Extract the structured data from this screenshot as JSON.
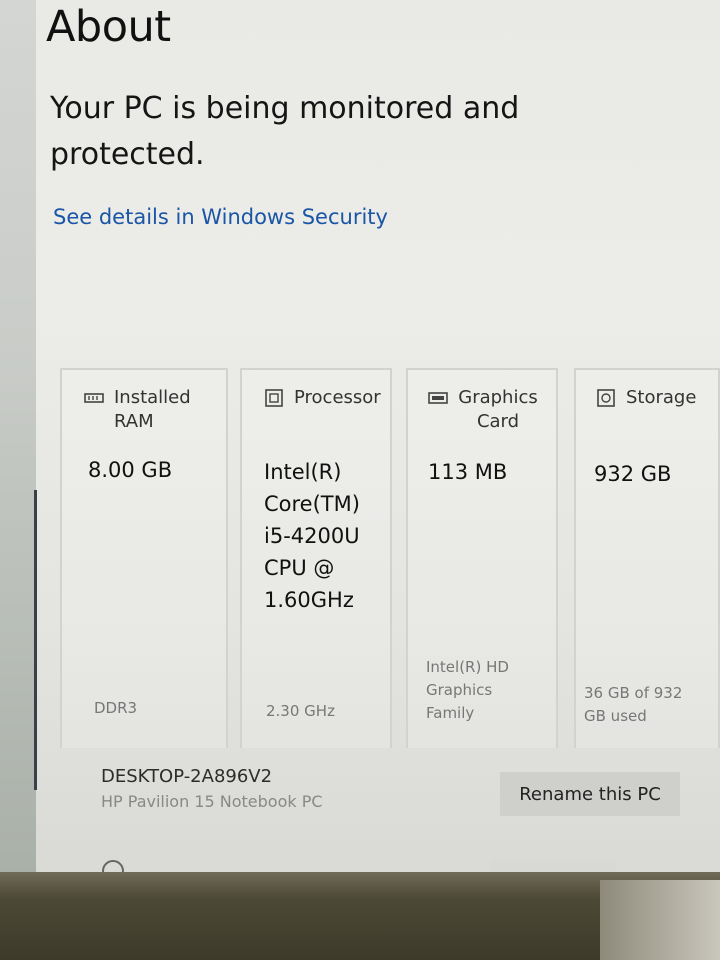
{
  "page": {
    "title": "About",
    "security_message": "Your PC is being monitored and protected.",
    "security_link": "See details in Windows Security"
  },
  "specs": [
    {
      "icon": "memory-icon",
      "label": "Installed RAM",
      "value": "8.00 GB",
      "detail": "DDR3"
    },
    {
      "icon": "processor-icon",
      "label": "Processor",
      "value": "Intel(R) Core(TM) i5-4200U CPU @ 1.60GHz",
      "detail": "2.30 GHz"
    },
    {
      "icon": "graphics-card-icon",
      "label": "Graphics Card",
      "value": "113 MB",
      "detail": "Intel(R) HD Graphics Family"
    },
    {
      "icon": "storage-icon",
      "label": "Storage",
      "value": "932 GB",
      "detail": "36 GB of 932 GB used"
    }
  ],
  "device": {
    "name": "DESKTOP-2A896V2",
    "model": "HP Pavilion 15 Notebook PC",
    "rename_label": "Rename this PC"
  },
  "colors": {
    "link": "#1a55a6",
    "button_bg": "#cfcfcc",
    "screen_bg": "#e9e9e6"
  }
}
